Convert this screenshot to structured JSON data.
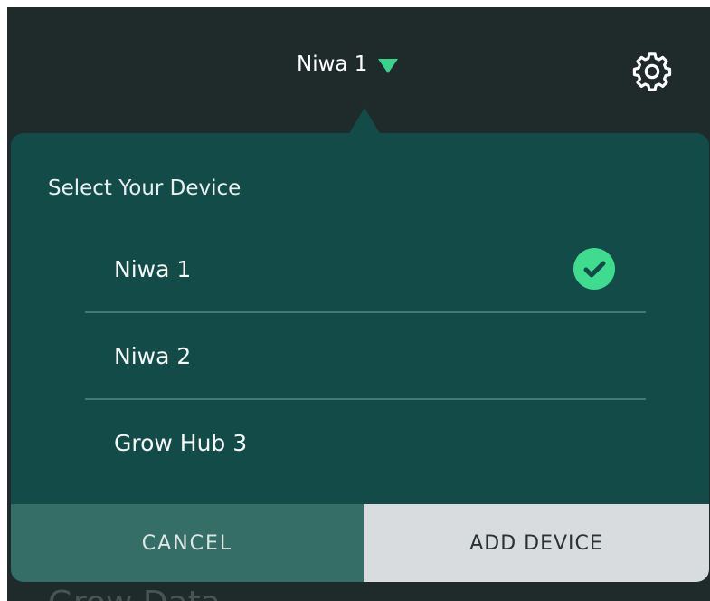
{
  "header": {
    "device_title": "Niwa 1",
    "caret_icon": "triangle-down-icon",
    "settings_icon": "gear-icon"
  },
  "background": {
    "section_title": "Grow Data"
  },
  "device_selector": {
    "title": "Select Your Device",
    "devices": [
      {
        "label": "Niwa 1",
        "selected": true
      },
      {
        "label": "Niwa 2",
        "selected": false
      },
      {
        "label": "Grow Hub 3",
        "selected": false
      }
    ],
    "check_icon": "check-circle-icon",
    "cancel_label": "CANCEL",
    "add_label": "ADD DEVICE"
  },
  "colors": {
    "header_bg": "#1f2a2b",
    "popover_bg": "#134b49",
    "accent_green": "#38d48c",
    "cancel_bg": "#356d67",
    "add_bg": "#d9dcde"
  }
}
